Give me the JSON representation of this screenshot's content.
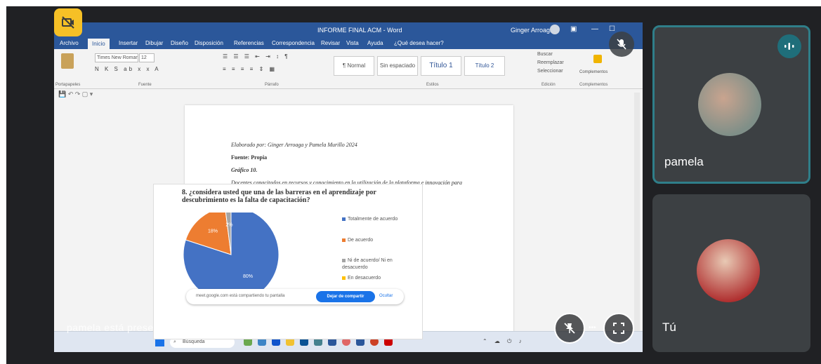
{
  "meeting": {
    "presenting_label": "pamela está presentando",
    "accent": "#2f7e89",
    "badge_color": "#f6c026"
  },
  "word": {
    "title": "INFORME FINAL ACM - Word",
    "user": "Ginger Arroaga",
    "menu": [
      "Archivo",
      "Inicio",
      "Insertar",
      "Dibujar",
      "Diseño",
      "Disposición",
      "Referencias",
      "Correspondencia",
      "Revisar",
      "Vista",
      "Ayuda",
      "¿Qué desea hacer?"
    ],
    "ribbon_groups": [
      "Portapapeles",
      "Fuente",
      "Párrafo",
      "Estilos",
      "Edición",
      "Complementos"
    ],
    "font_name": "Times New Roman",
    "font_size": "12",
    "styles": [
      "¶ Normal",
      "Sin espaciado",
      "Título 1",
      "Título 2"
    ],
    "edit_items": [
      "Buscar",
      "Reemplazar",
      "Seleccionar"
    ],
    "addins_label": "Complementos"
  },
  "document": {
    "elaborado": "Elaborado por: Ginger Arroaga y Pamela Murillo 2024",
    "fuente": "Fuente: Propia",
    "grafico": "Gráfico 10.",
    "caption": "Docentes capacitados en recursos y conocimiento en la utilización de la plataforma e innovación para incentivar su aprendizaje por descubrimiento."
  },
  "chart_data": {
    "type": "pie",
    "title": "8. ¿considera usted que una de las barreras en el aprendizaje por descubrimiento es la falta de capacitación?",
    "categories": [
      "Totalmente de acuerdo",
      "De acuerdo",
      "Ni de acuerdo/ Ni en desacuerdo",
      "En desacuerdo"
    ],
    "values": [
      80,
      18,
      2,
      0
    ],
    "colors": [
      "#4472c4",
      "#ed7d31",
      "#a5a5a5",
      "#ffc000"
    ],
    "data_labels": [
      "80%",
      "18%",
      "2%"
    ]
  },
  "share_bar": {
    "message": "meet.google.com está compartiendo tu pantalla",
    "stop_label": "Dejar de compartir",
    "hide_label": "Ocultar"
  },
  "taskbar": {
    "search_placeholder": "Búsqueda"
  },
  "participants": [
    {
      "name": "pamela"
    },
    {
      "name": "Tú"
    }
  ]
}
